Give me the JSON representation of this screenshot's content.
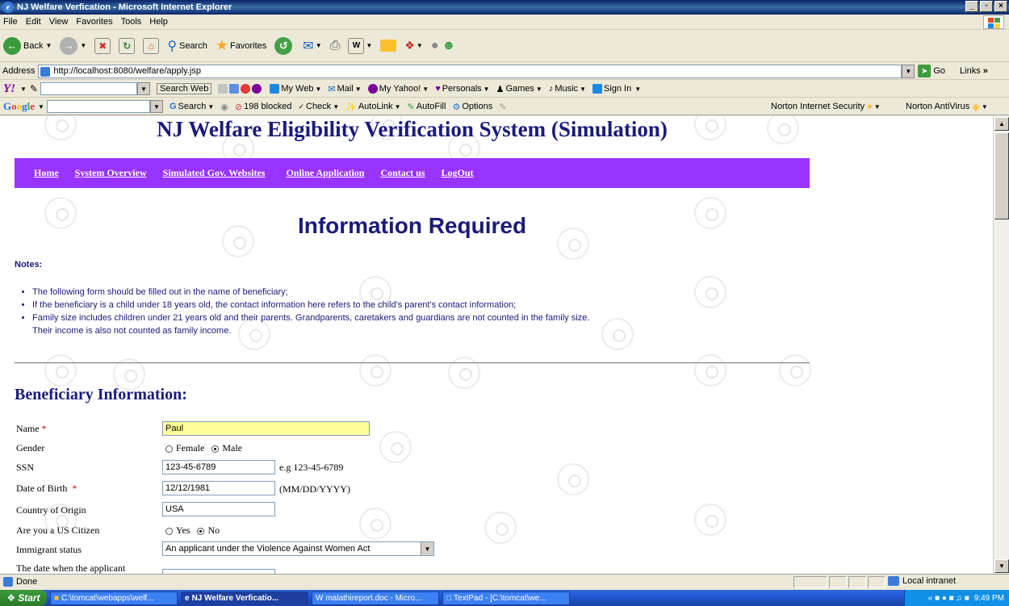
{
  "window": {
    "title": "NJ Welfare Verfication - Microsoft Internet Explorer",
    "min": "_",
    "max": "▫",
    "close": "×"
  },
  "menu": [
    "File",
    "Edit",
    "View",
    "Favorites",
    "Tools",
    "Help"
  ],
  "toolbar": {
    "back": "Back",
    "search": "Search",
    "favorites": "Favorites"
  },
  "address": {
    "label": "Address",
    "url": "http://localhost:8080/welfare/apply.jsp",
    "go": "Go",
    "links": "Links"
  },
  "yahoo_bar": {
    "logo": "Y!",
    "search_web": "Search Web",
    "my_web": "My Web",
    "mail": "Mail",
    "my_yahoo": "My Yahoo!",
    "personals": "Personals",
    "games": "Games",
    "music": "Music",
    "sign_in": "Sign In"
  },
  "google_bar": {
    "logo": "Google",
    "search": "Search",
    "blocked": "198 blocked",
    "check": "Check",
    "autolink": "AutoLink",
    "autofill": "AutoFill",
    "options": "Options",
    "norton_security": "Norton Internet Security",
    "norton_antivirus": "Norton AntiVirus"
  },
  "page": {
    "site_title": "NJ Welfare Eligibility Verification System (Simulation)",
    "nav": [
      "Home",
      "System Overview",
      "Simulated Gov. Websites",
      "Online Application",
      "Contact us",
      "LogOut"
    ],
    "heading": "Information Required",
    "notes_label": "Notes:",
    "notes": [
      "The following form should be filled out in the name of beneficiary;",
      "If the beneficiary is a child under 18 years old, the contact information here refers to the child's parent's contact information;",
      "Family size includes children under 21 years old and their parents. Grandparents, caretakers and guardians are not counted in the family size."
    ],
    "notes_continuation": "Their income is also not counted as family income.",
    "section_heading": "Beneficiary Information:",
    "form": {
      "name_label": "Name",
      "name_value": "Paul",
      "gender_label": "Gender",
      "gender_female": "Female",
      "gender_male": "Male",
      "ssn_label": "SSN",
      "ssn_value": "123-45-6789",
      "ssn_hint": "e.g 123-45-6789",
      "dob_label": "Date of Birth",
      "dob_value": "12/12/1981",
      "dob_hint": "(MM/DD/YYYY)",
      "country_label": "Country of Origin",
      "country_value": "USA",
      "citizen_label": "Are you a US Citizen",
      "citizen_yes": "Yes",
      "citizen_no": "No",
      "immigrant_label": "Immigrant status",
      "immigrant_value": "An applicant under the Violence Against Women Act",
      "date_label": "The date when the applicant",
      "required_mark": "*"
    }
  },
  "status": {
    "text": "Done",
    "zone": "Local intranet"
  },
  "taskbar": {
    "start": "Start",
    "tasks": [
      "C:\\tomcat\\webapps\\welf...",
      "NJ Welfare Verficatio...",
      "malathireport.doc - Micro...",
      "TextPad - [C:\\tomcat\\we..."
    ],
    "time": "9:49 PM"
  },
  "colors": {
    "nav_bg": "#9933ff",
    "title_color": "#1a1a7a",
    "required": "#cc0000",
    "name_field_bg": "#ffff99"
  }
}
